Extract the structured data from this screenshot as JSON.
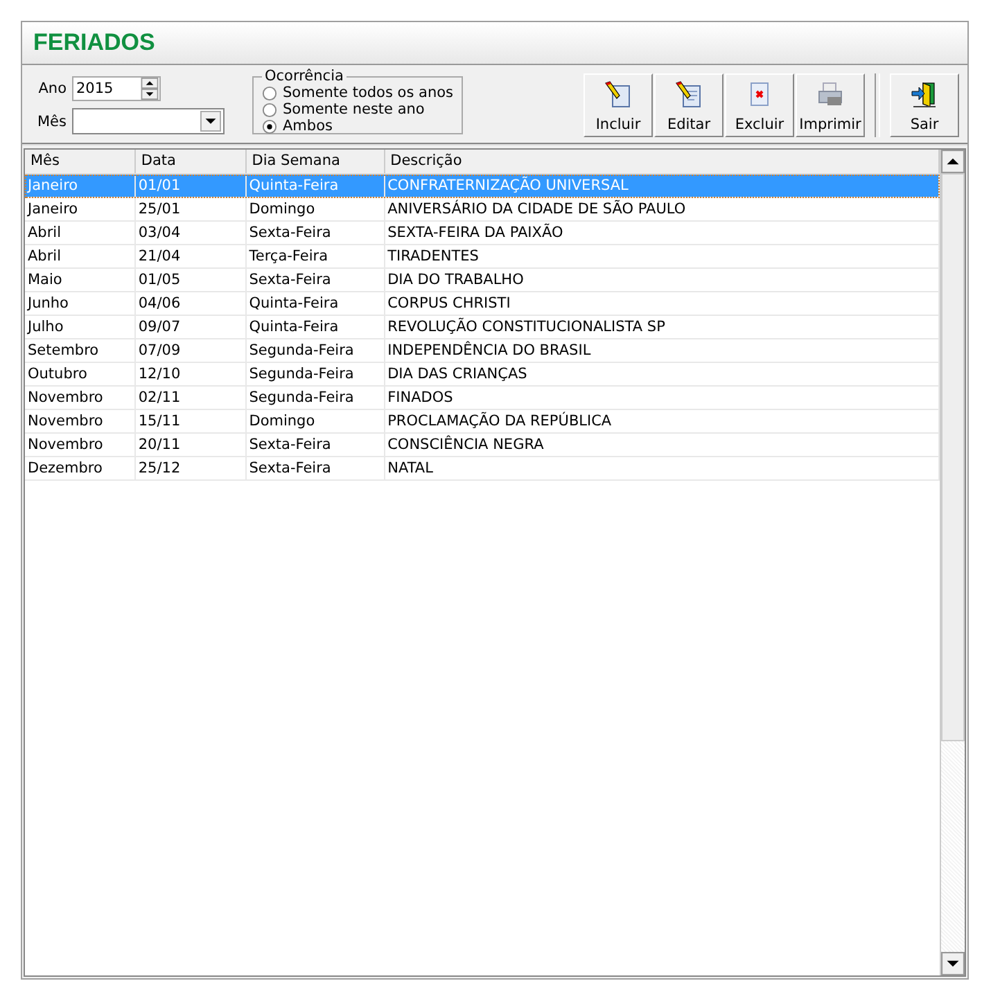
{
  "title": "FERIADOS",
  "ano": {
    "label": "Ano",
    "value": "2015"
  },
  "mes": {
    "label": "Mês"
  },
  "ocorrencia": {
    "legend": "Ocorrência",
    "options": [
      {
        "label": "Somente todos os anos",
        "selected": false
      },
      {
        "label": "Somente neste ano",
        "selected": false
      },
      {
        "label": "Ambos",
        "selected": true
      }
    ]
  },
  "buttons": [
    {
      "label": "Incluir",
      "kind": "add"
    },
    {
      "label": "Editar",
      "kind": "edit"
    },
    {
      "label": "Excluir",
      "kind": "delete"
    },
    {
      "label": "Imprimir",
      "kind": "print"
    },
    {
      "label": "Sair",
      "kind": "exit"
    }
  ],
  "table": {
    "columns": [
      "Mês",
      "Data",
      "Dia Semana",
      "Descrição"
    ],
    "rows": [
      {
        "cells": [
          "Janeiro",
          "01/01",
          "Quinta-Feira",
          "CONFRATERNIZAÇÃO UNIVERSAL"
        ],
        "selected": true
      },
      {
        "cells": [
          "Janeiro",
          "25/01",
          "Domingo",
          "ANIVERSÁRIO DA CIDADE DE SÃO PAULO"
        ],
        "selected": false
      },
      {
        "cells": [
          "Abril",
          "03/04",
          "Sexta-Feira",
          "SEXTA-FEIRA DA PAIXÃO"
        ],
        "selected": false
      },
      {
        "cells": [
          "Abril",
          "21/04",
          "Terça-Feira",
          "TIRADENTES"
        ],
        "selected": false
      },
      {
        "cells": [
          "Maio",
          "01/05",
          "Sexta-Feira",
          "DIA DO TRABALHO"
        ],
        "selected": false
      },
      {
        "cells": [
          "Junho",
          "04/06",
          "Quinta-Feira",
          "CORPUS CHRISTI"
        ],
        "selected": false
      },
      {
        "cells": [
          "Julho",
          "09/07",
          "Quinta-Feira",
          "REVOLUÇÃO CONSTITUCIONALISTA SP"
        ],
        "selected": false
      },
      {
        "cells": [
          "Setembro",
          "07/09",
          "Segunda-Feira",
          "INDEPENDÊNCIA DO BRASIL"
        ],
        "selected": false
      },
      {
        "cells": [
          "Outubro",
          "12/10",
          "Segunda-Feira",
          "DIA DAS CRIANÇAS"
        ],
        "selected": false
      },
      {
        "cells": [
          "Novembro",
          "02/11",
          "Segunda-Feira",
          "FINADOS"
        ],
        "selected": false
      },
      {
        "cells": [
          "Novembro",
          "15/11",
          "Domingo",
          "PROCLAMAÇÃO DA REPÚBLICA"
        ],
        "selected": false
      },
      {
        "cells": [
          "Novembro",
          "20/11",
          "Sexta-Feira",
          "CONSCIÊNCIA NEGRA"
        ],
        "selected": false
      },
      {
        "cells": [
          "Dezembro",
          "25/12",
          "Sexta-Feira",
          "NATAL"
        ],
        "selected": false
      }
    ]
  }
}
